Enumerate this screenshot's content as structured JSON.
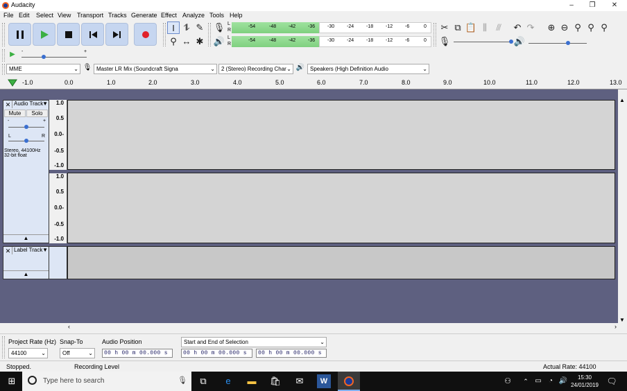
{
  "window": {
    "title": "Audacity",
    "controls": [
      "–",
      "❐",
      "✕"
    ]
  },
  "menu": [
    "File",
    "Edit",
    "Select",
    "View",
    "Transport",
    "Tracks",
    "Generate",
    "Effect",
    "Analyze",
    "Tools",
    "Help"
  ],
  "meter": {
    "lr": [
      "L",
      "R"
    ],
    "ticks": [
      "-54",
      "-48",
      "-42",
      "-36",
      "-30",
      "-24",
      "-18",
      "-12",
      "-6",
      "0"
    ]
  },
  "devices": {
    "host": "MME",
    "input": "Master LR Mix (Soundcraft Signa",
    "channels": "2 (Stereo) Recording Char",
    "output": "Speakers (High Definition Audio"
  },
  "ruler": [
    "-1.0",
    "0.0",
    "1.0",
    "2.0",
    "3.0",
    "4.0",
    "5.0",
    "6.0",
    "7.0",
    "8.0",
    "9.0",
    "10.0",
    "11.0",
    "12.0",
    "13.0"
  ],
  "audio_track": {
    "name": "Audio Track",
    "mute": "Mute",
    "solo": "Solo",
    "minus": "-",
    "plus": "+",
    "left": "L",
    "right": "R",
    "info1": "Stereo, 44100Hz",
    "info2": "32-bit float",
    "scale": [
      "1.0",
      "0.5",
      "0.0-",
      "-0.5",
      "-1.0"
    ],
    "scale2": [
      "1.0",
      "0.5",
      "0.0-",
      "-0.5",
      "-1.0"
    ]
  },
  "label_track": {
    "name": "Label Track"
  },
  "selection": {
    "rate_label": "Project Rate (Hz)",
    "rate": "44100",
    "snap_label": "Snap-To",
    "snap": "Off",
    "pos_label": "Audio Position",
    "mode": "Start and End of Selection",
    "time1": "00 h 00 m 00.000 s",
    "time2": "00 h 00 m 00.000 s",
    "time3": "00 h 00 m 00.000 s"
  },
  "status": {
    "state": "Stopped.",
    "level": "Recording Level",
    "rate": "Actual Rate: 44100"
  },
  "taskbar": {
    "search": "Type here to search",
    "time": "15:30",
    "date": "24/01/2019"
  }
}
